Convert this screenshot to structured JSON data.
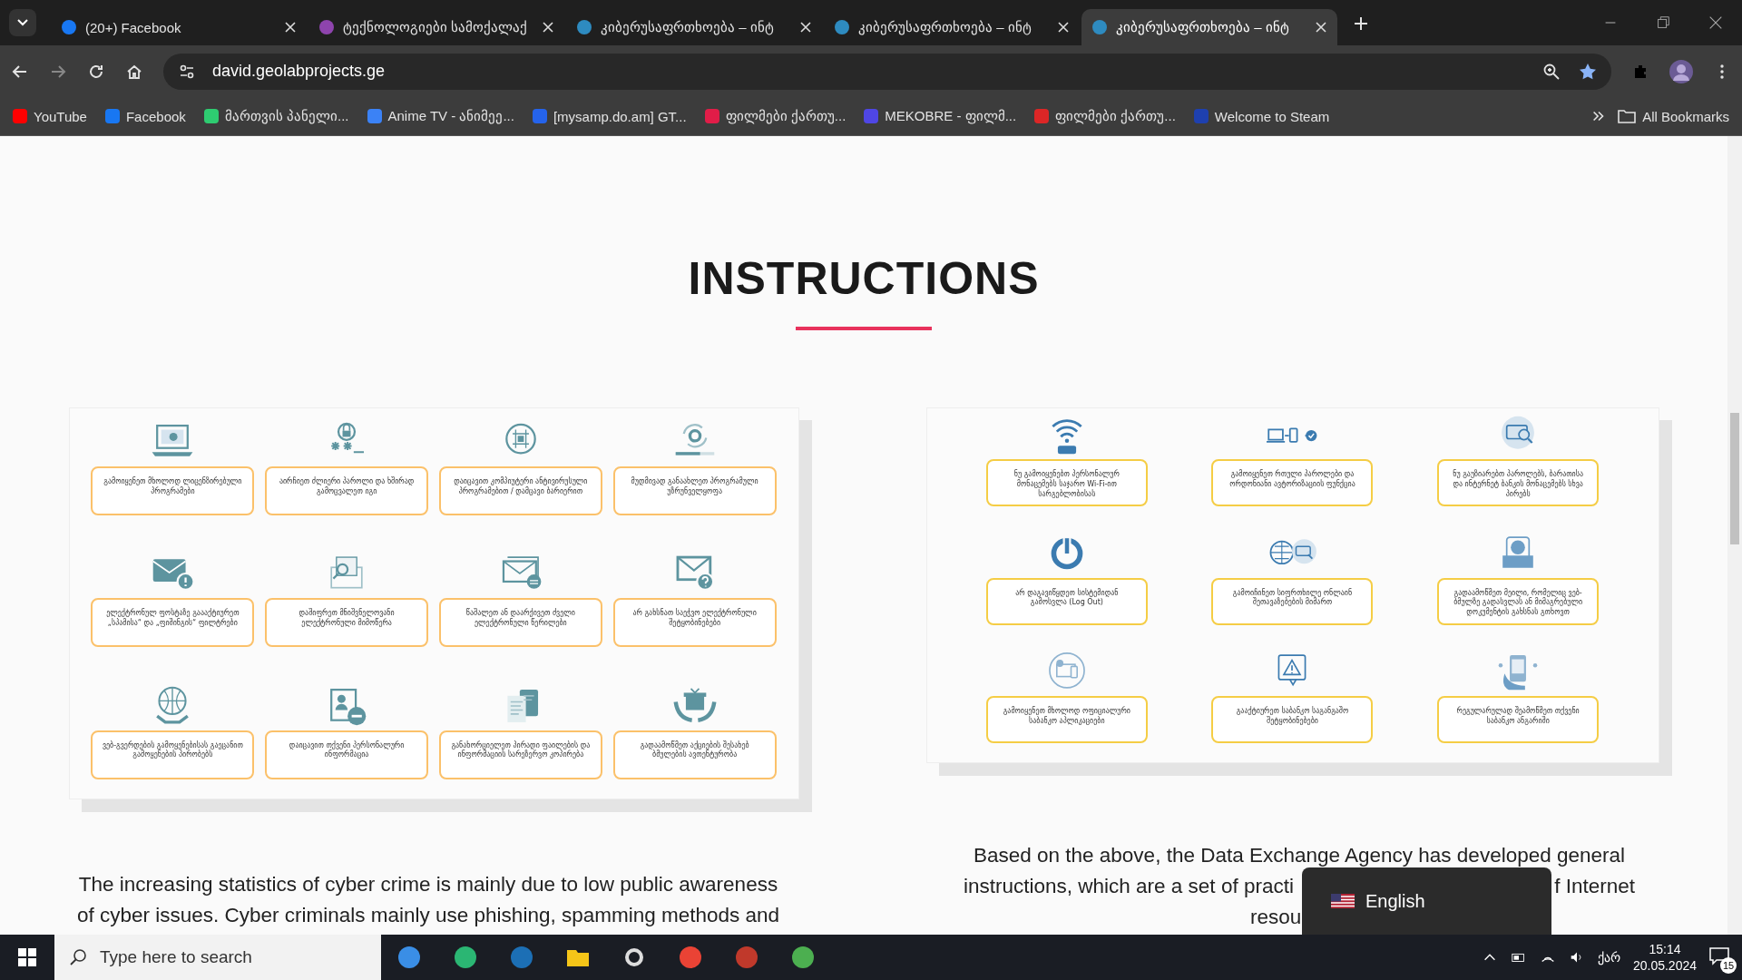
{
  "browser": {
    "tabs": [
      {
        "title": "(20+) Facebook",
        "selected": false
      },
      {
        "title": "ტექნოლოგიები სამოქალაქ",
        "selected": false
      },
      {
        "title": "კიბერუსაფრთხოება – ინტ",
        "selected": false
      },
      {
        "title": "კიბერუსაფრთხოება – ინტ",
        "selected": false
      },
      {
        "title": "კიბერუსაფრთხოება – ინტ",
        "selected": true
      }
    ],
    "address": "david.geolabprojects.ge",
    "bookmarks": [
      "YouTube",
      "Facebook",
      "მართვის პანელი...",
      "Anime TV - ანიმეე...",
      "[mysamp.do.am] GT...",
      "ფილმები ქართუ...",
      "MEKOBRE - ფილმ...",
      "ფილმები ქართუ...",
      "Welcome to Steam"
    ],
    "all_bookmarks": "All Bookmarks"
  },
  "page": {
    "heading": "INSTRUCTIONS",
    "infographics": [
      {
        "tips": [
          "გამოიყენეთ მხოლოდ ლიცენზირებული პროგრამები",
          "აირჩიეთ ძლიერი პაროლი და ხშირად გამოცვალეთ იგი",
          "დაიცავით კომპიუტერი ანტივირუსული პროგრამებით / დამცავი ბარიერით",
          "მუდმივად განაახლეთ პროგრამული უზრუნველყოფა",
          "ელექტრონულ ფოსტაზე გაააქტიურეთ „სპამისა“ და „ფიშინგის“ ფილტრები",
          "დაშიფრეთ მნიშვნელოვანი ელექტრონული მიმოწერა",
          "წაშალეთ ან დაარქივეთ ძველი ელექტრონული წერილები",
          "არ გახსნათ საეჭვო ელექტრონული შეტყობინებები",
          "ვებ-გვერდების გამოყენებისას გაეცანით გამოყენების პირობებს",
          "დაიცავით თქვენი პერსონალური ინფორმაცია",
          "განახორციელეთ პირადი ფაილების და ინფორმაციის სარეზერვო კოპირება",
          "გადაამოწმეთ აქციების შესახებ ბმულების ავთენტურობა"
        ]
      },
      {
        "tips": [
          "ნუ გამოიყენებთ პერსონალურ მონაცემებს საჯარო Wi-Fi-ით სარგებლობისას",
          "გამოიყენეთ რთული პაროლები და ორდონიანი ავტორიზაციის ფუნქცია",
          "ნუ გაუზიარებთ პაროლებს, ბარათისა და ინტერნეტ ბანკის მონაცემებს სხვა პირებს",
          "არ დაგავიწყდეთ სისტემიდან გამოსვლა (Log Out)",
          "გამოიჩინეთ სიფრთხილე ონლაინ შეთავაზებების მიმართ",
          "გადაამოწმეთ მეილი, რომელიც ვებ-ბმულზე გადასვლას ან მიმაგრებული დოკუმენტის გახსნას გთხოვთ",
          "გამოიყენეთ მხოლოდ ოფიციალური საბანკო აპლიკაციები",
          "გააქტიურეთ საბანკო საგანგაშო შეტყობინებები",
          "რეგულარულად შეამოწმეთ თქვენი საბანკო ანგარიში"
        ]
      }
    ],
    "left_paragraph": [
      "The increasing statistics of cyber crime is mainly due to low public awareness",
      "of cyber issues. Cyber criminals mainly use phishing, spamming methods and"
    ],
    "right_paragraph": [
      {
        "left": "Based on the above, the Data Exchange Agency has developed general"
      },
      {
        "left": "instructions, which are a set of practi",
        "right": "f Internet"
      },
      {
        "left": "resou"
      }
    ]
  },
  "language_popup": {
    "label": "English"
  },
  "taskbar": {
    "search_placeholder": "Type here to search",
    "keyboard": "ქარ",
    "time": "15:14",
    "date": "20.05.2024",
    "notifications": "15"
  }
}
